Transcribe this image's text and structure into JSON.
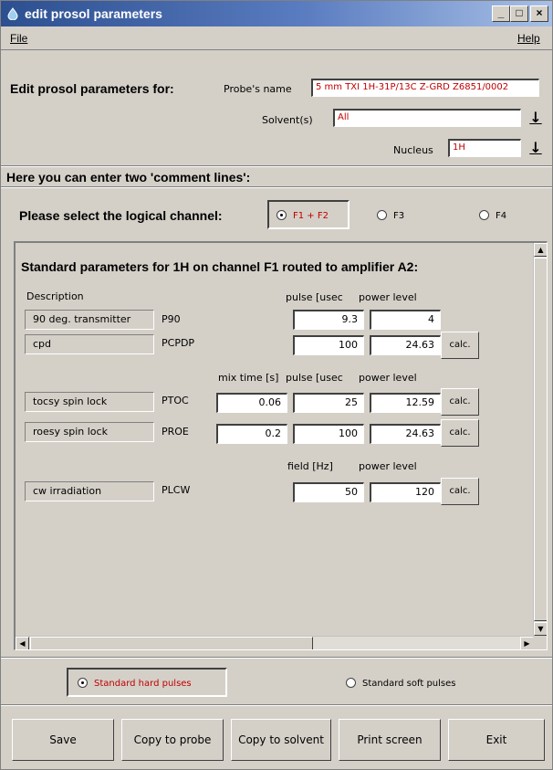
{
  "window": {
    "title": "edit prosol parameters",
    "icon": "app-drop-icon",
    "controls": [
      "_",
      "□",
      "×"
    ]
  },
  "menu": {
    "file": "File",
    "help": "Help"
  },
  "header": {
    "edit_label": "Edit prosol parameters for:",
    "probe_label": "Probe's name",
    "probe_value": "5 mm TXI 1H-31P/13C Z-GRD Z6851/0002",
    "solvent_label": "Solvent(s)",
    "solvent_value": "All",
    "nucleus_label": "Nucleus",
    "nucleus_value": "1H",
    "dropdown_glyph": "↓"
  },
  "comment_heading": "Here you can enter two 'comment lines':",
  "channel": {
    "label": "Please select the logical channel:",
    "options": [
      "F1 + F2",
      "F3",
      "F4"
    ],
    "selected": "F1 + F2"
  },
  "panel": {
    "title": "Standard parameters for 1H on channel F1 routed to amplifier A2:",
    "description_header": "Description",
    "calc_label": "calc.",
    "group1": {
      "col_pulse": "pulse [usec",
      "col_power": "power level",
      "rows": [
        {
          "desc": "90 deg. transmitter",
          "param": "P90",
          "pulse": "9.3",
          "power": "4",
          "has_calc": false
        },
        {
          "desc": "cpd",
          "param": "PCPDP",
          "pulse": "100",
          "power": "24.63",
          "has_calc": true
        }
      ]
    },
    "group2": {
      "col_mix": "mix time [s]",
      "col_pulse": "pulse [usec",
      "col_power": "power level",
      "rows": [
        {
          "desc": "tocsy spin lock",
          "param": "PTOC",
          "mix": "0.06",
          "pulse": "25",
          "power": "12.59",
          "has_calc": true
        },
        {
          "desc": "roesy spin lock",
          "param": "PROE",
          "mix": "0.2",
          "pulse": "100",
          "power": "24.63",
          "has_calc": true
        }
      ]
    },
    "group3": {
      "col_field": "field [Hz]",
      "col_power": "power level",
      "rows": [
        {
          "desc": "cw irradiation",
          "param": "PLCW",
          "field": "50",
          "power": "120",
          "has_calc": true
        }
      ]
    }
  },
  "pulse_type": {
    "options": [
      "Standard hard pulses",
      "Standard soft pulses"
    ],
    "selected": "Standard hard pulses"
  },
  "buttons": {
    "save": "Save",
    "copy_probe": "Copy to probe",
    "copy_solvent": "Copy to solvent",
    "print": "Print screen",
    "exit": "Exit"
  },
  "colors": {
    "accent_red": "#c00000",
    "title_blue": "#2c4f90"
  }
}
